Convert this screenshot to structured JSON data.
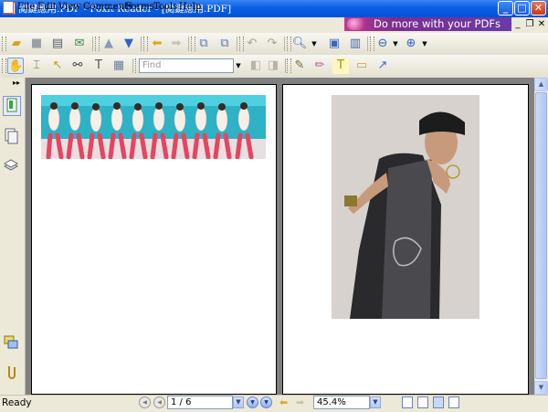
{
  "window": {
    "title": "閱鍵應用.PDF - Foxit Reader - [閱鍵應用.PDF]",
    "controls": {
      "minimize": "_",
      "maximize": "□",
      "close": "✕"
    }
  },
  "menu": {
    "items": [
      {
        "label": "File",
        "key": "F"
      },
      {
        "label": "Edit",
        "key": "E"
      },
      {
        "label": "View",
        "key": "V"
      },
      {
        "label": "Comments",
        "key": "C"
      },
      {
        "label": "Forms",
        "key": "o"
      },
      {
        "label": "Tools",
        "key": "T"
      },
      {
        "label": "Help",
        "key": "H"
      }
    ],
    "promo": "Do more with your PDFs",
    "mdi": {
      "minimize": "_",
      "restore": "❐",
      "close": "✕"
    }
  },
  "toolbar": {
    "find_placeholder": "Find"
  },
  "pages": {
    "left_image_desc_colors": [
      "#2fb7c9",
      "#f2f2f2",
      "#e63b5c"
    ],
    "right_image_bg": "#d7d2cd"
  },
  "status": {
    "text": "Ready",
    "page_field": "1 / 6",
    "zoom_field": "45.4%"
  },
  "colors": {
    "titlebar": "#0a5fe3",
    "promo": "#7a2f8e",
    "doc_background": "#808080"
  }
}
